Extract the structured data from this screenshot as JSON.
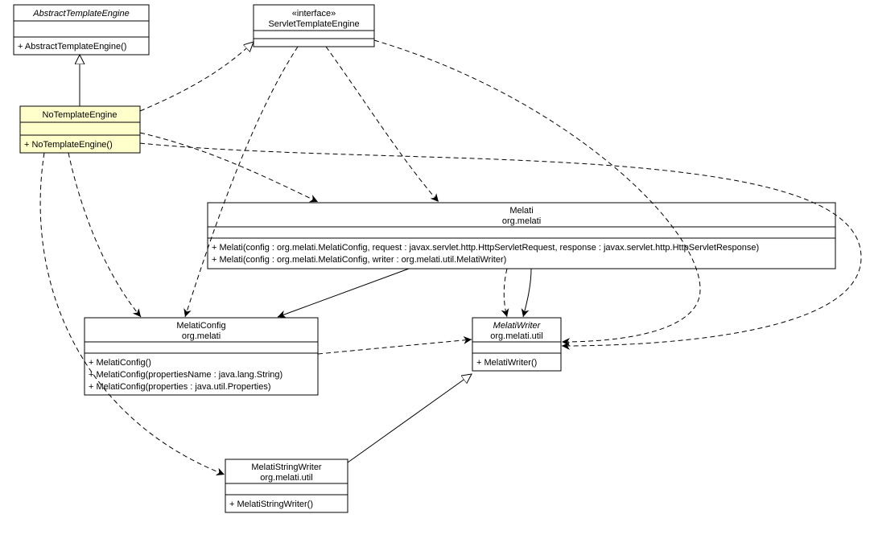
{
  "classes": {
    "abstractTemplateEngine": {
      "name": "AbstractTemplateEngine",
      "ops": [
        "+ AbstractTemplateEngine()"
      ]
    },
    "servletTemplateEngine": {
      "stereo": "«interface»",
      "name": "ServletTemplateEngine"
    },
    "noTemplateEngine": {
      "name": "NoTemplateEngine",
      "ops": [
        "+ NoTemplateEngine()"
      ]
    },
    "melati": {
      "name": "Melati",
      "pkg": "org.melati",
      "ops": [
        "+ Melati(config : org.melati.MelatiConfig, request : javax.servlet.http.HttpServletRequest, response : javax.servlet.http.HttpServletResponse)",
        "+ Melati(config : org.melati.MelatiConfig, writer : org.melati.util.MelatiWriter)"
      ]
    },
    "melatiConfig": {
      "name": "MelatiConfig",
      "pkg": "org.melati",
      "ops": [
        "+ MelatiConfig()",
        "+ MelatiConfig(propertiesName : java.lang.String)",
        "+ MelatiConfig(properties : java.util.Properties)"
      ]
    },
    "melatiWriter": {
      "name": "MelatiWriter",
      "pkg": "org.melati.util",
      "ops": [
        "+ MelatiWriter()"
      ]
    },
    "melatiStringWriter": {
      "name": "MelatiStringWriter",
      "pkg": "org.melati.util",
      "ops": [
        "+ MelatiStringWriter()"
      ]
    }
  }
}
